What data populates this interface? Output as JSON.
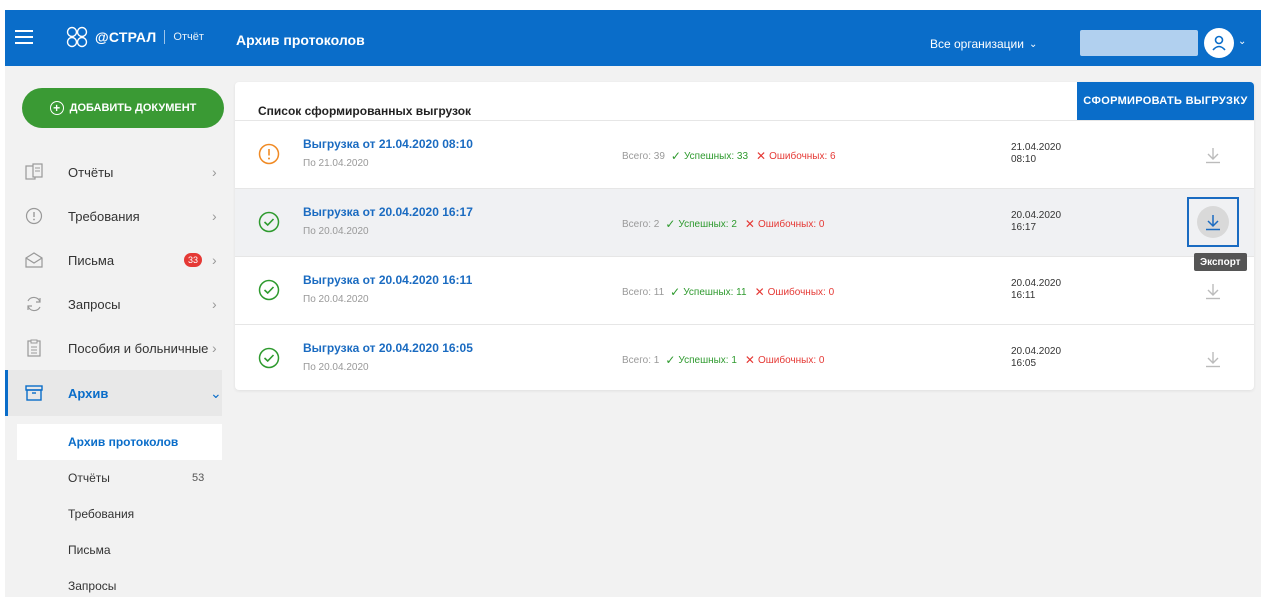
{
  "header": {
    "logo_text": "@СТРАЛ",
    "logo_sub": "Отчёт",
    "title": "Архив протоколов",
    "orgs_label": "Все организации"
  },
  "sidebar": {
    "add_button": "ДОБАВИТЬ ДОКУМЕНТ",
    "items": [
      {
        "label": "Отчёты",
        "icon": "reports-icon"
      },
      {
        "label": "Требования",
        "icon": "requirement-icon"
      },
      {
        "label": "Письма",
        "icon": "mail-icon",
        "badge": "33"
      },
      {
        "label": "Запросы",
        "icon": "refresh-icon"
      },
      {
        "label": "Пособия и больничные",
        "icon": "clipboard-icon"
      },
      {
        "label": "Архив",
        "icon": "archive-icon"
      }
    ],
    "sub_items": [
      {
        "label": "Архив протоколов"
      },
      {
        "label": "Отчёты",
        "count": "53"
      },
      {
        "label": "Требования"
      },
      {
        "label": "Письма"
      },
      {
        "label": "Запросы"
      }
    ]
  },
  "main": {
    "card_title": "Список сформированных выгрузок",
    "generate_button": "СФОРМИРОВАТЬ ВЫГРУЗКУ",
    "tooltip": "Экспорт",
    "rows": [
      {
        "status": "warning",
        "title": "Выгрузка от 21.04.2020 08:10",
        "sub": "По 21.04.2020",
        "total": "Всего: 39",
        "ok": "Успешных: 33",
        "err": "Ошибочных: 6",
        "date": "21.04.2020",
        "time": "08:10"
      },
      {
        "status": "success",
        "title": "Выгрузка от 20.04.2020 16:17",
        "sub": "По 20.04.2020",
        "total": "Всего: 2",
        "ok": "Успешных: 2",
        "err": "Ошибочных: 0",
        "date": "20.04.2020",
        "time": "16:17"
      },
      {
        "status": "success",
        "title": "Выгрузка от 20.04.2020 16:11",
        "sub": "По 20.04.2020",
        "total": "Всего: 11",
        "ok": "Успешных: 11",
        "err": "Ошибочных: 0",
        "date": "20.04.2020",
        "time": "16:11"
      },
      {
        "status": "success",
        "title": "Выгрузка от 20.04.2020 16:05",
        "sub": "По 20.04.2020",
        "total": "Всего: 1",
        "ok": "Успешных: 1",
        "err": "Ошибочных: 0",
        "date": "20.04.2020",
        "time": "16:05"
      }
    ]
  },
  "colors": {
    "brand": "#0a6dc9",
    "add_button": "#3a9a34",
    "success": "#2e9a2e",
    "warning": "#f08a24",
    "error": "#e53935"
  }
}
